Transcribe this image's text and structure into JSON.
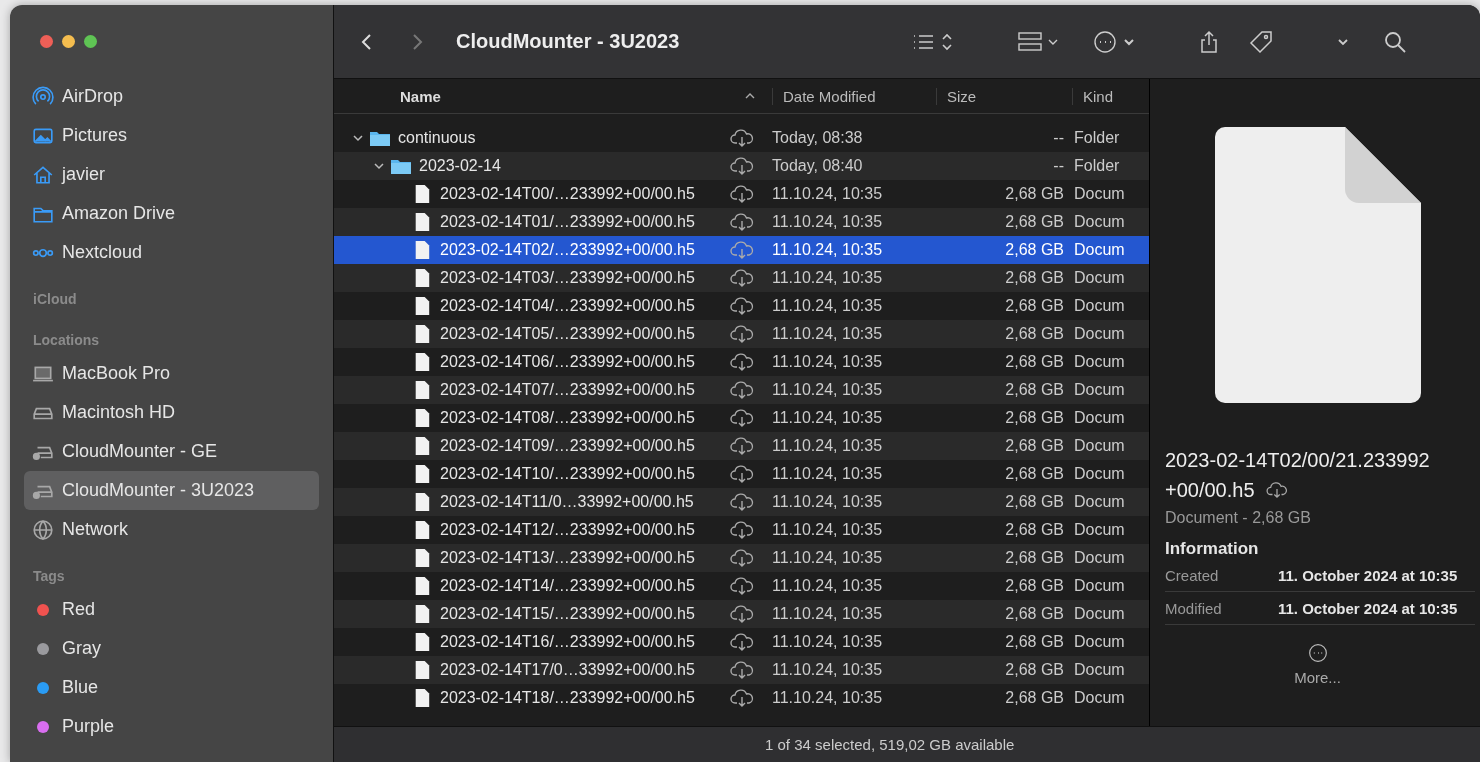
{
  "window": {
    "title": "CloudMounter - 3U2023"
  },
  "sidebar": {
    "sections": [
      {
        "items": [
          {
            "label": "AirDrop",
            "kind": "airdrop",
            "selected": false
          },
          {
            "label": "Pictures",
            "kind": "pictures",
            "selected": false
          },
          {
            "label": "javier",
            "kind": "home",
            "selected": false
          },
          {
            "label": "Amazon Drive",
            "kind": "folder",
            "selected": false
          },
          {
            "label": "Nextcloud",
            "kind": "nextcloud",
            "selected": false
          }
        ]
      },
      {
        "heading": "iCloud"
      },
      {
        "heading": "Locations",
        "items": [
          {
            "label": "MacBook Pro",
            "kind": "laptop",
            "selected": false
          },
          {
            "label": "Macintosh HD",
            "kind": "disk",
            "selected": false
          },
          {
            "label": "CloudMounter - GE",
            "kind": "clouddisk",
            "selected": false
          },
          {
            "label": "CloudMounter - 3U2023",
            "kind": "clouddisk",
            "selected": true
          },
          {
            "label": "Network",
            "kind": "globe",
            "selected": false
          }
        ]
      },
      {
        "heading": "Tags",
        "items": [
          {
            "label": "Red",
            "kind": "tag",
            "color": "#f0524f",
            "selected": false
          },
          {
            "label": "Gray",
            "kind": "tag",
            "color": "#9a9a9e",
            "selected": false
          },
          {
            "label": "Blue",
            "kind": "tag",
            "color": "#2a9cf5",
            "selected": false
          },
          {
            "label": "Purple",
            "kind": "tag",
            "color": "#d96ef0",
            "selected": false
          }
        ]
      }
    ]
  },
  "table": {
    "columns": [
      "Name",
      "Date Modified",
      "Size",
      "Kind"
    ],
    "rows": [
      {
        "kind": "folder",
        "name": "continuous",
        "date": "Today, 08:38",
        "size": "--",
        "type": "Folder",
        "expanded": true,
        "selected": false,
        "children": [
          {
            "kind": "folder",
            "name": "2023-02-14",
            "date": "Today, 08:40",
            "size": "--",
            "type": "Folder",
            "expanded": true,
            "selected": false,
            "children": [
              {
                "kind": "file",
                "name": "2023-02-14T00/…233992+00/00.h5",
                "date": "11.10.24, 10:35",
                "size": "2,68 GB",
                "type": "Docum",
                "selected": false
              },
              {
                "kind": "file",
                "name": "2023-02-14T01/…233992+00/00.h5",
                "date": "11.10.24, 10:35",
                "size": "2,68 GB",
                "type": "Docum",
                "selected": false
              },
              {
                "kind": "file",
                "name": "2023-02-14T02/…233992+00/00.h5",
                "date": "11.10.24, 10:35",
                "size": "2,68 GB",
                "type": "Docum",
                "selected": true
              },
              {
                "kind": "file",
                "name": "2023-02-14T03/…233992+00/00.h5",
                "date": "11.10.24, 10:35",
                "size": "2,68 GB",
                "type": "Docum",
                "selected": false
              },
              {
                "kind": "file",
                "name": "2023-02-14T04/…233992+00/00.h5",
                "date": "11.10.24, 10:35",
                "size": "2,68 GB",
                "type": "Docum",
                "selected": false
              },
              {
                "kind": "file",
                "name": "2023-02-14T05/…233992+00/00.h5",
                "date": "11.10.24, 10:35",
                "size": "2,68 GB",
                "type": "Docum",
                "selected": false
              },
              {
                "kind": "file",
                "name": "2023-02-14T06/…233992+00/00.h5",
                "date": "11.10.24, 10:35",
                "size": "2,68 GB",
                "type": "Docum",
                "selected": false
              },
              {
                "kind": "file",
                "name": "2023-02-14T07/…233992+00/00.h5",
                "date": "11.10.24, 10:35",
                "size": "2,68 GB",
                "type": "Docum",
                "selected": false
              },
              {
                "kind": "file",
                "name": "2023-02-14T08/…233992+00/00.h5",
                "date": "11.10.24, 10:35",
                "size": "2,68 GB",
                "type": "Docum",
                "selected": false
              },
              {
                "kind": "file",
                "name": "2023-02-14T09/…233992+00/00.h5",
                "date": "11.10.24, 10:35",
                "size": "2,68 GB",
                "type": "Docum",
                "selected": false
              },
              {
                "kind": "file",
                "name": "2023-02-14T10/…233992+00/00.h5",
                "date": "11.10.24, 10:35",
                "size": "2,68 GB",
                "type": "Docum",
                "selected": false
              },
              {
                "kind": "file",
                "name": "2023-02-14T11/0…33992+00/00.h5",
                "date": "11.10.24, 10:35",
                "size": "2,68 GB",
                "type": "Docum",
                "selected": false
              },
              {
                "kind": "file",
                "name": "2023-02-14T12/…233992+00/00.h5",
                "date": "11.10.24, 10:35",
                "size": "2,68 GB",
                "type": "Docum",
                "selected": false
              },
              {
                "kind": "file",
                "name": "2023-02-14T13/…233992+00/00.h5",
                "date": "11.10.24, 10:35",
                "size": "2,68 GB",
                "type": "Docum",
                "selected": false
              },
              {
                "kind": "file",
                "name": "2023-02-14T14/…233992+00/00.h5",
                "date": "11.10.24, 10:35",
                "size": "2,68 GB",
                "type": "Docum",
                "selected": false
              },
              {
                "kind": "file",
                "name": "2023-02-14T15/…233992+00/00.h5",
                "date": "11.10.24, 10:35",
                "size": "2,68 GB",
                "type": "Docum",
                "selected": false
              },
              {
                "kind": "file",
                "name": "2023-02-14T16/…233992+00/00.h5",
                "date": "11.10.24, 10:35",
                "size": "2,68 GB",
                "type": "Docum",
                "selected": false
              },
              {
                "kind": "file",
                "name": "2023-02-14T17/0…33992+00/00.h5",
                "date": "11.10.24, 10:35",
                "size": "2,68 GB",
                "type": "Docum",
                "selected": false
              },
              {
                "kind": "file",
                "name": "2023-02-14T18/…233992+00/00.h5",
                "date": "11.10.24, 10:35",
                "size": "2,68 GB",
                "type": "Docum",
                "selected": false
              }
            ]
          }
        ]
      }
    ]
  },
  "preview": {
    "filename": "2023-02-14T02/00/21.233992+00/00.h5",
    "subtitle": "Document - 2,68 GB",
    "info_heading": "Information",
    "info": [
      {
        "label": "Created",
        "value": "11. October 2024 at 10:35"
      },
      {
        "label": "Modified",
        "value": "11. October 2024 at 10:35"
      }
    ],
    "more": "More..."
  },
  "status_bar": "1 of 34 selected, 519,02 GB available"
}
